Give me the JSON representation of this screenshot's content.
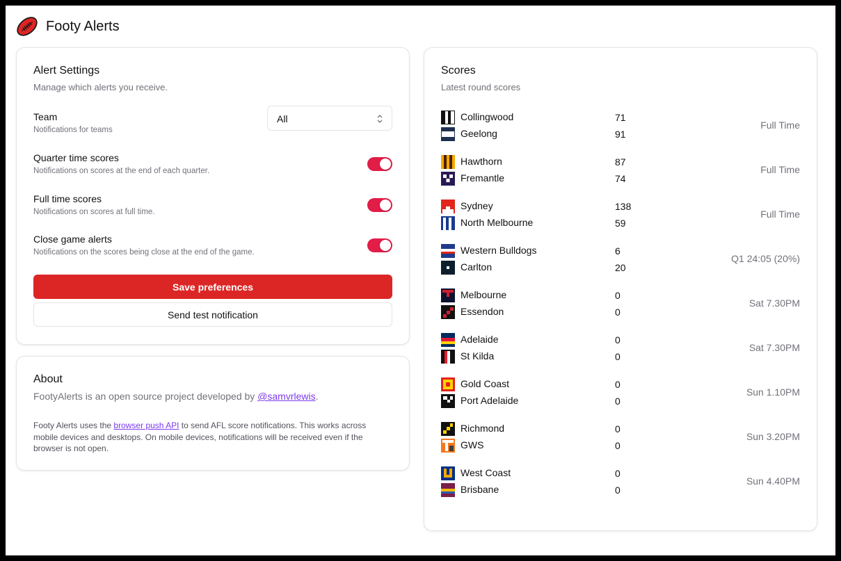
{
  "app": {
    "title": "Footy Alerts",
    "logo_icon": "football-icon",
    "brand_color": "#dc2626"
  },
  "alert_settings": {
    "title": "Alert Settings",
    "description": "Manage which alerts you receive.",
    "team": {
      "label": "Team",
      "description": "Notifications for teams",
      "selected": "All"
    },
    "toggles": [
      {
        "label": "Quarter time scores",
        "description": "Notifications on scores at the end of each quarter.",
        "on": true
      },
      {
        "label": "Full time scores",
        "description": "Notifications on scores at full time.",
        "on": true
      },
      {
        "label": "Close game alerts",
        "description": "Notifications on the scores being close at the end of the game.",
        "on": true
      }
    ],
    "save_label": "Save preferences",
    "test_label": "Send test notification",
    "toggle_color": "#e11d48"
  },
  "about": {
    "title": "About",
    "line_prefix": "FootyAlerts is an open source project developed by ",
    "line_link": "@samvrlewis",
    "line_suffix": ".",
    "detail_prefix": "Footy Alerts uses the ",
    "detail_link": "browser push API",
    "detail_suffix": " to send AFL score notifications. This works across mobile devices and desktops. On mobile devices, notifications will be received even if the browser is not open."
  },
  "scores": {
    "title": "Scores",
    "description": "Latest round scores",
    "games": [
      {
        "home": {
          "name": "Collingwood",
          "score": "71"
        },
        "away": {
          "name": "Geelong",
          "score": "91"
        },
        "status": "Full Time"
      },
      {
        "home": {
          "name": "Hawthorn",
          "score": "87"
        },
        "away": {
          "name": "Fremantle",
          "score": "74"
        },
        "status": "Full Time"
      },
      {
        "home": {
          "name": "Sydney",
          "score": "138"
        },
        "away": {
          "name": "North Melbourne",
          "score": "59"
        },
        "status": "Full Time"
      },
      {
        "home": {
          "name": "Western Bulldogs",
          "score": "6"
        },
        "away": {
          "name": "Carlton",
          "score": "20"
        },
        "status": "Q1 24:05 (20%)"
      },
      {
        "home": {
          "name": "Melbourne",
          "score": "0"
        },
        "away": {
          "name": "Essendon",
          "score": "0"
        },
        "status": "Sat 7.30PM"
      },
      {
        "home": {
          "name": "Adelaide",
          "score": "0"
        },
        "away": {
          "name": "St Kilda",
          "score": "0"
        },
        "status": "Sat 7.30PM"
      },
      {
        "home": {
          "name": "Gold Coast",
          "score": "0"
        },
        "away": {
          "name": "Port Adelaide",
          "score": "0"
        },
        "status": "Sun 1.10PM"
      },
      {
        "home": {
          "name": "Richmond",
          "score": "0"
        },
        "away": {
          "name": "GWS",
          "score": "0"
        },
        "status": "Sun 3.20PM"
      },
      {
        "home": {
          "name": "West Coast",
          "score": "0"
        },
        "away": {
          "name": "Brisbane",
          "score": "0"
        },
        "status": "Sun 4.40PM"
      }
    ]
  }
}
